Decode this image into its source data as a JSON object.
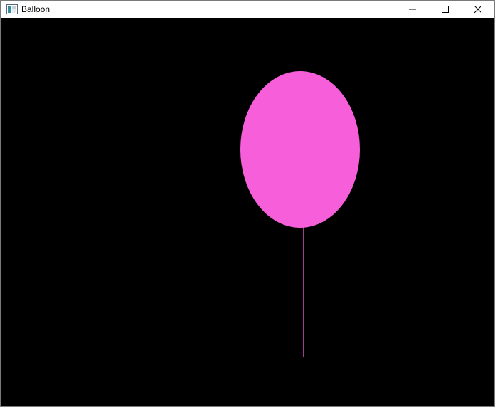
{
  "window": {
    "title": "Balloon",
    "controls": {
      "minimize_icon": "minimize-icon",
      "maximize_icon": "maximize-icon",
      "close_icon": "close-icon"
    }
  },
  "scene": {
    "background_color": "#000000",
    "balloon_color": "#f75ed9",
    "string_color": "#f75ed9"
  }
}
